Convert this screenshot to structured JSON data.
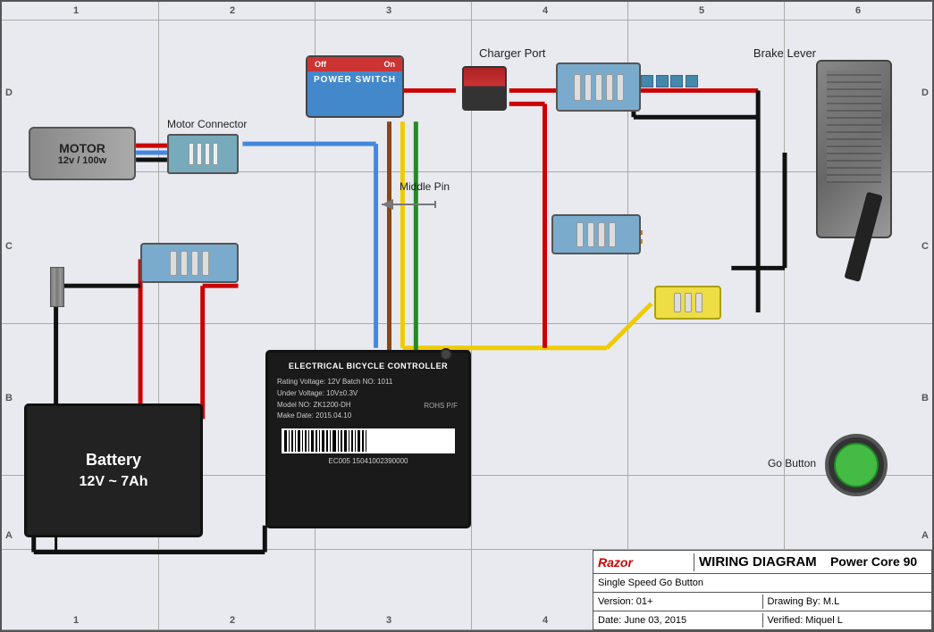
{
  "title": "Wiring Diagram",
  "diagram": {
    "title": "WIRING DIAGRAM",
    "subtitle": "Single Speed Go Button",
    "model": "Power Core 90",
    "version": "Version: 01+",
    "date": "Date: June 03, 2015",
    "drawing_by": "Drawing By: M.L",
    "verified": "Verified: Miquel L",
    "logo": "Razor",
    "components": {
      "motor": {
        "label": "MOTOR",
        "specs": "12v / 100w"
      },
      "charger_port": {
        "label": "Charger Port"
      },
      "brake_lever": {
        "label": "Brake Lever"
      },
      "motor_connector": {
        "label": "Motor Connector"
      },
      "middle_pin": {
        "label": "Middle Pin"
      },
      "battery": {
        "label": "Battery",
        "specs": "12V ~ 7Ah"
      },
      "go_button": {
        "label": "Go Button"
      },
      "controller": {
        "title": "ELECTRICAL BICYCLE CONTROLLER",
        "rating": "Rating Voltage: 12V  Batch NO:  1011",
        "under": "Under Voltage: 10V±0.3V",
        "model": "Model NO:  ZK1200-DH",
        "make_date": "Make Date:  2015.04.10",
        "rohs": "ROHS P/F",
        "ec": "EC005   15041002390000"
      },
      "power_switch": {
        "label": "POWER SWITCH",
        "off": "Off",
        "on": "On"
      }
    }
  },
  "grid": {
    "columns": [
      "1",
      "2",
      "3",
      "4",
      "5",
      "6"
    ],
    "rows": [
      "D",
      "C",
      "B",
      "A"
    ]
  }
}
